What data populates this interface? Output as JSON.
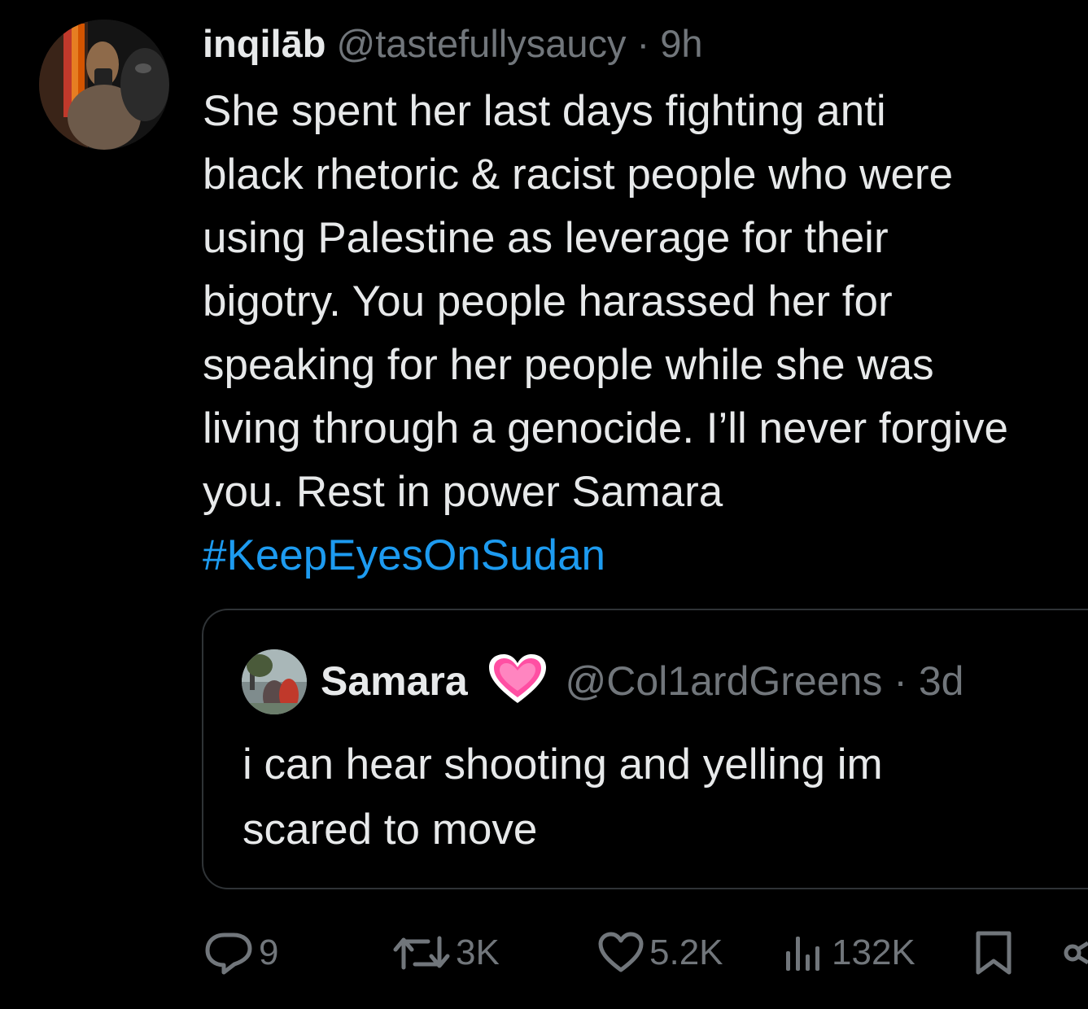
{
  "tweet": {
    "display_name": "inqilāb",
    "handle": "@tastefullysaucy",
    "separator": "·",
    "time": "9h",
    "text_lines": [
      "She spent her last days fighting anti",
      "black rhetoric & racist people who were",
      "using Palestine as leverage for their",
      "bigotry. You people harassed her for",
      "speaking for her people while she was",
      "living through a genocide. I’ll never forgive",
      "you. Rest in power Samara"
    ],
    "hashtag": "#KeepEyesOnSudan"
  },
  "quote": {
    "display_name": "Samara",
    "emoji_icon": "sparkling-heart-icon",
    "handle": "@Col1ardGreens",
    "separator": "·",
    "time": "3d",
    "text_lines": [
      "i can hear shooting and yelling im",
      "scared to move"
    ]
  },
  "actions": {
    "replies": "9",
    "reposts": "3K",
    "likes": "5.2K",
    "views": "132K"
  },
  "colors": {
    "background": "#000000",
    "text": "#e7e9ea",
    "secondary": "#71767b",
    "link": "#1d9bf0",
    "border": "#2f3336",
    "heart_emoji": "#ff4fa3"
  }
}
